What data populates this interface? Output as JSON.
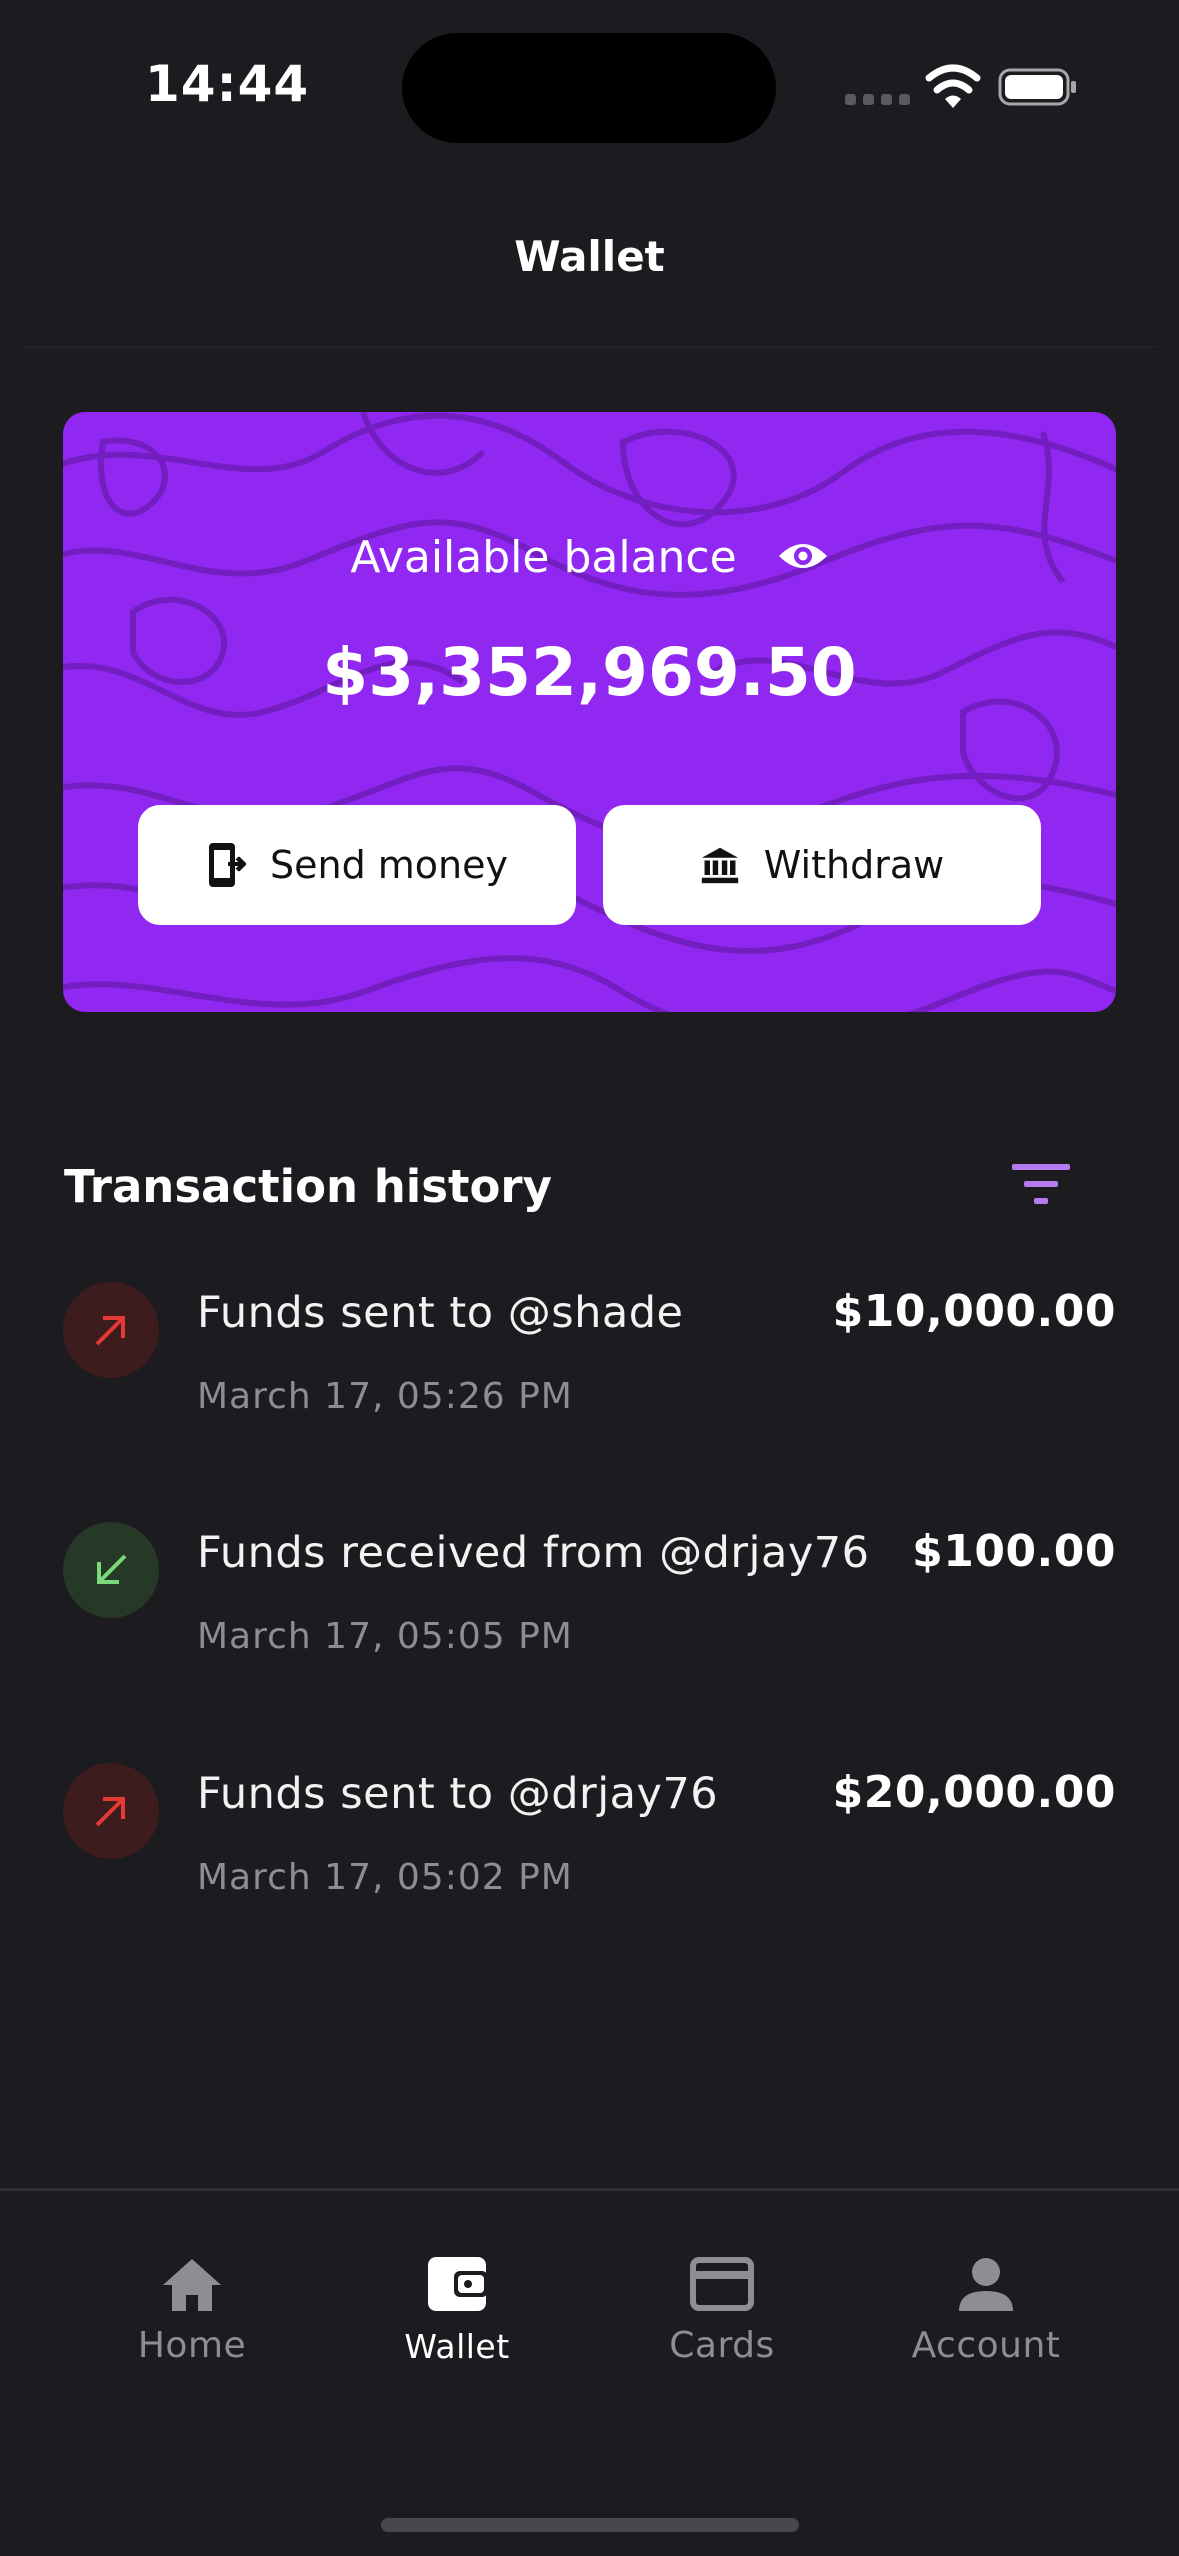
{
  "status_bar": {
    "time": "14:44"
  },
  "header": {
    "title": "Wallet"
  },
  "balance_card": {
    "label": "Available balance",
    "amount": "$3,352,969.50",
    "send_label": "Send money",
    "withdraw_label": "Withdraw",
    "background_color": "#9128f1"
  },
  "transactions": {
    "title": "Transaction history",
    "items": [
      {
        "direction": "out",
        "description": "Funds sent to @shade",
        "date": "March 17, 05:26 PM",
        "amount": "$10,000.00"
      },
      {
        "direction": "in",
        "description": "Funds received from @drjay76",
        "date": "March 17, 05:05 PM",
        "amount": "$100.00"
      },
      {
        "direction": "out",
        "description": "Funds sent to @drjay76",
        "date": "March 17, 05:02 PM",
        "amount": "$20,000.00"
      }
    ]
  },
  "bottom_nav": {
    "items": [
      {
        "label": "Home",
        "icon": "home-icon",
        "active": false
      },
      {
        "label": "Wallet",
        "icon": "wallet-icon",
        "active": true
      },
      {
        "label": "Cards",
        "icon": "card-icon",
        "active": false
      },
      {
        "label": "Account",
        "icon": "account-icon",
        "active": false
      }
    ]
  },
  "colors": {
    "accent": "#9128f1",
    "filter_icon": "#b47cf0",
    "sent": "#e53935",
    "received": "#7ad97a"
  }
}
